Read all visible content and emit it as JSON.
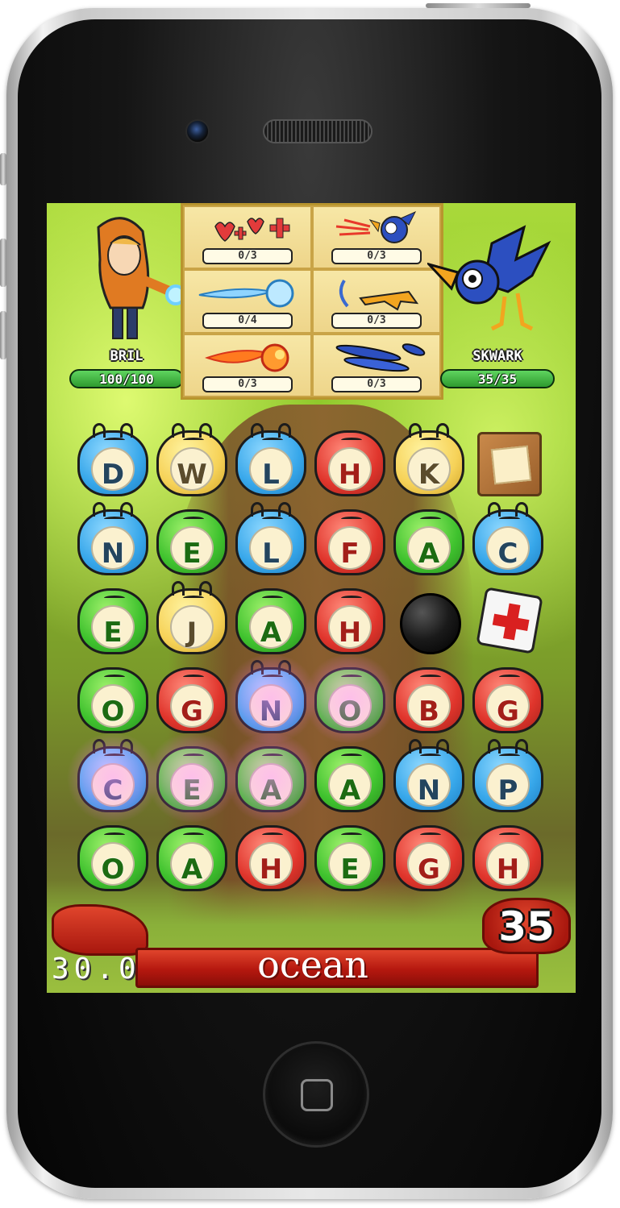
{
  "player": {
    "name": "BRIL",
    "hp": "100/100",
    "hp_fraction": 1.0
  },
  "enemy": {
    "name": "SKWARK",
    "hp": "35/35",
    "hp_fraction": 1.0
  },
  "spells": [
    {
      "icon": "hearts-heal-icon",
      "count": "0/3"
    },
    {
      "icon": "bird-fire-icon",
      "count": "0/3"
    },
    {
      "icon": "ice-blast-icon",
      "count": "0/4"
    },
    {
      "icon": "claw-icon",
      "count": "0/3"
    },
    {
      "icon": "fireball-icon",
      "count": "0/3"
    },
    {
      "icon": "feathers-icon",
      "count": "0/3"
    }
  ],
  "board": [
    [
      {
        "l": "D",
        "c": "blue"
      },
      {
        "l": "W",
        "c": "yellow"
      },
      {
        "l": "L",
        "c": "blue"
      },
      {
        "l": "H",
        "c": "red"
      },
      {
        "l": "K",
        "c": "yellow"
      },
      {
        "special": "scroll"
      }
    ],
    [
      {
        "l": "N",
        "c": "blue"
      },
      {
        "l": "E",
        "c": "green"
      },
      {
        "l": "L",
        "c": "blue"
      },
      {
        "l": "F",
        "c": "red"
      },
      {
        "l": "A",
        "c": "green"
      },
      {
        "l": "C",
        "c": "blue"
      }
    ],
    [
      {
        "l": "E",
        "c": "green"
      },
      {
        "l": "J",
        "c": "yellow"
      },
      {
        "l": "A",
        "c": "green"
      },
      {
        "l": "H",
        "c": "red"
      },
      {
        "special": "bomb"
      },
      {
        "special": "medkit"
      }
    ],
    [
      {
        "l": "O",
        "c": "green"
      },
      {
        "l": "G",
        "c": "red"
      },
      {
        "l": "N",
        "c": "blue",
        "glow": true
      },
      {
        "l": "O",
        "c": "green",
        "glow": true
      },
      {
        "l": "B",
        "c": "red"
      },
      {
        "l": "G",
        "c": "red"
      }
    ],
    [
      {
        "l": "C",
        "c": "blue",
        "glow": true
      },
      {
        "l": "E",
        "c": "green",
        "glow": true
      },
      {
        "l": "A",
        "c": "green",
        "glow": true
      },
      {
        "l": "A",
        "c": "green"
      },
      {
        "l": "N",
        "c": "blue"
      },
      {
        "l": "P",
        "c": "blue"
      }
    ],
    [
      {
        "l": "O",
        "c": "green"
      },
      {
        "l": "A",
        "c": "green"
      },
      {
        "l": "H",
        "c": "red"
      },
      {
        "l": "E",
        "c": "green"
      },
      {
        "l": "G",
        "c": "red"
      },
      {
        "l": "H",
        "c": "red"
      }
    ]
  ],
  "status": {
    "timer": "30.0",
    "current_word": "ocean",
    "score": "35"
  },
  "colors": {
    "blue": "#37a7ea",
    "green": "#3fc22e",
    "red": "#e0352c",
    "yellow": "#f6d258"
  }
}
